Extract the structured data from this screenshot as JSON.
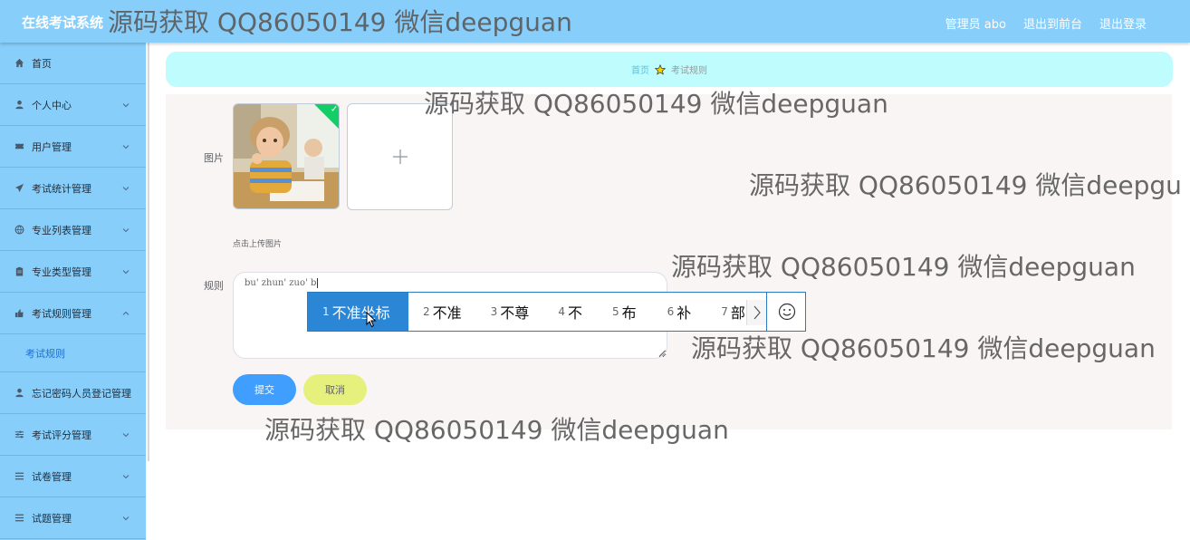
{
  "header": {
    "app_title": "在线考试系统",
    "links": [
      "管理员 abo",
      "退出到前台",
      "退出登录"
    ]
  },
  "sidebar": {
    "items": [
      {
        "label": "首页",
        "icon": "home-icon",
        "expandable": false
      },
      {
        "label": "个人中心",
        "icon": "user-icon",
        "expandable": true
      },
      {
        "label": "用户管理",
        "icon": "ticket-icon",
        "expandable": true
      },
      {
        "label": "考试统计管理",
        "icon": "paper-plane-icon",
        "expandable": true
      },
      {
        "label": "专业列表管理",
        "icon": "globe-icon",
        "expandable": true
      },
      {
        "label": "专业类型管理",
        "icon": "clipboard-icon",
        "expandable": true
      },
      {
        "label": "考试规则管理",
        "icon": "thumbs-up-icon",
        "expandable": true,
        "expanded": true
      },
      {
        "label": "忘记密码人员登记管理",
        "icon": "user-icon",
        "expandable": false
      },
      {
        "label": "考试评分管理",
        "icon": "sliders-icon",
        "expandable": true
      },
      {
        "label": "试卷管理",
        "icon": "list-icon",
        "expandable": true
      },
      {
        "label": "试题管理",
        "icon": "list-icon",
        "expandable": true
      }
    ],
    "submenu": {
      "label": "考试规则"
    }
  },
  "breadcrumb": {
    "home": "首页",
    "current": "考试规则"
  },
  "form": {
    "image_label": "图片",
    "upload_hint": "点击上传图片",
    "rule_label": "规则",
    "rule_value": "bu' zhun' zuo' b",
    "submit_label": "提交",
    "cancel_label": "取消"
  },
  "ime": {
    "candidates": [
      {
        "num": "1",
        "text": "不准坐标"
      },
      {
        "num": "2",
        "text": "不准"
      },
      {
        "num": "3",
        "text": "不尊"
      },
      {
        "num": "4",
        "text": "不"
      },
      {
        "num": "5",
        "text": "布"
      },
      {
        "num": "6",
        "text": "补"
      },
      {
        "num": "7",
        "text": "部"
      }
    ],
    "active_index": 0
  },
  "watermarks": [
    "源码获取 QQ86050149 微信deepguan",
    "源码获取 QQ86050149 微信deepguan",
    "源码获取 QQ86050149 微信deepgu",
    "源码获取 QQ86050149 微信deepguan",
    "源码获取 QQ86050149 微信deepguan",
    "源码获取 QQ86050149 微信deepguan"
  ],
  "colors": {
    "header_bg": "#87cefa",
    "sidebar_bg": "#87cefa",
    "breadcrumb_bg": "#bffcfe",
    "submit_bg": "#409eff",
    "cancel_bg": "#e6f07c",
    "ime_active": "#2b86d6"
  }
}
